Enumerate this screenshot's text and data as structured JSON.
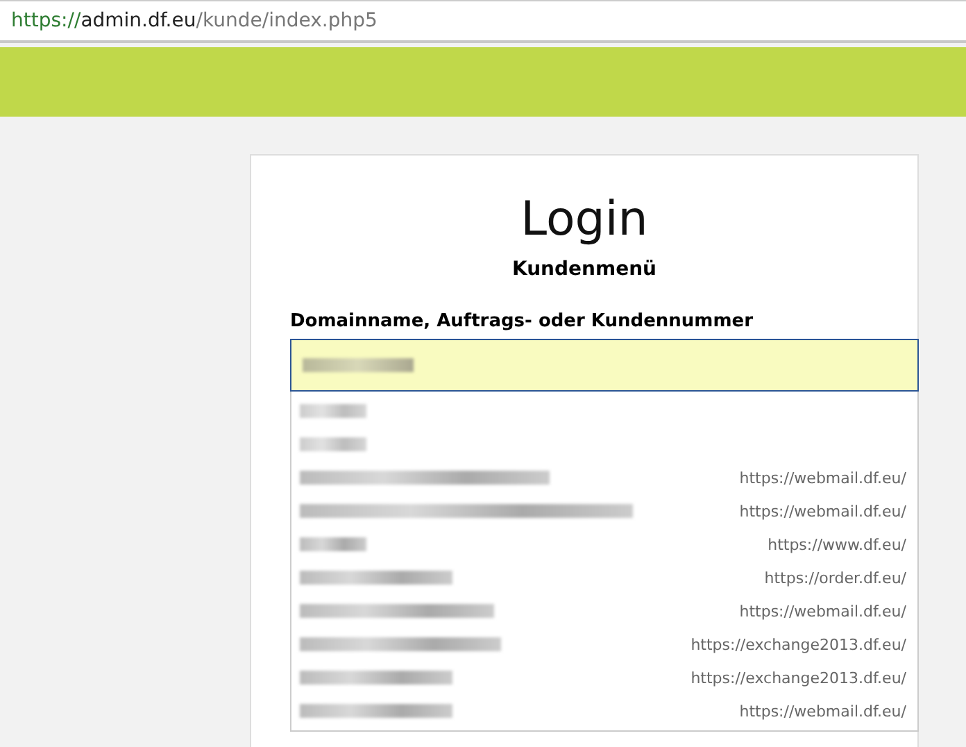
{
  "address_bar": {
    "scheme": "https://",
    "host": "admin.df.eu",
    "path": "/kunde/index.php5"
  },
  "login": {
    "title": "Login",
    "subtitle": "Kundenmenü",
    "field_label": "Domainname, Auftrags- oder Kundennummer"
  },
  "suggestions": [
    {
      "kind": "local"
    },
    {
      "kind": "local"
    },
    {
      "url": "https://webmail.df.eu/"
    },
    {
      "url": "https://webmail.df.eu/"
    },
    {
      "url": "https://www.df.eu/"
    },
    {
      "url": "https://order.df.eu/"
    },
    {
      "url": "https://webmail.df.eu/"
    },
    {
      "url": "https://exchange2013.df.eu/"
    },
    {
      "url": "https://exchange2013.df.eu/"
    },
    {
      "url": "https://webmail.df.eu/"
    }
  ]
}
